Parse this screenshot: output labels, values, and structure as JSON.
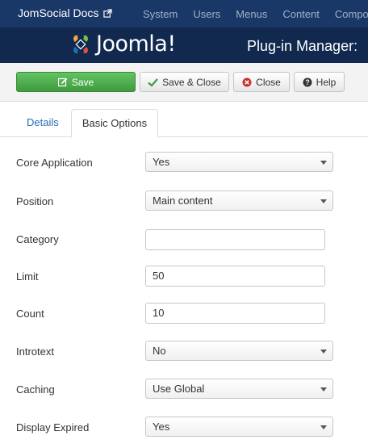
{
  "navbar": {
    "site_name": "JomSocial Docs",
    "menu": [
      "System",
      "Users",
      "Menus",
      "Content",
      "Compo"
    ]
  },
  "header": {
    "logo_text": "Joomla!",
    "page_title": "Plug-in Manager:"
  },
  "toolbar": {
    "save_label": "Save",
    "save_close_label": "Save & Close",
    "close_label": "Close",
    "help_label": "Help"
  },
  "tabs": {
    "details": "Details",
    "basic_options": "Basic Options"
  },
  "form": {
    "core_application": {
      "label": "Core Application",
      "value": "Yes"
    },
    "position": {
      "label": "Position",
      "value": "Main content"
    },
    "category": {
      "label": "Category",
      "value": ""
    },
    "limit": {
      "label": "Limit",
      "value": "50"
    },
    "count": {
      "label": "Count",
      "value": "10"
    },
    "introtext": {
      "label": "Introtext",
      "value": "No"
    },
    "caching": {
      "label": "Caching",
      "value": "Use Global"
    },
    "display_expired": {
      "label": "Display Expired",
      "value": "Yes"
    }
  },
  "colors": {
    "navbar": "#1a3867",
    "header": "#11294f",
    "save_button": "#51a351",
    "link": "#2a6eb0"
  }
}
